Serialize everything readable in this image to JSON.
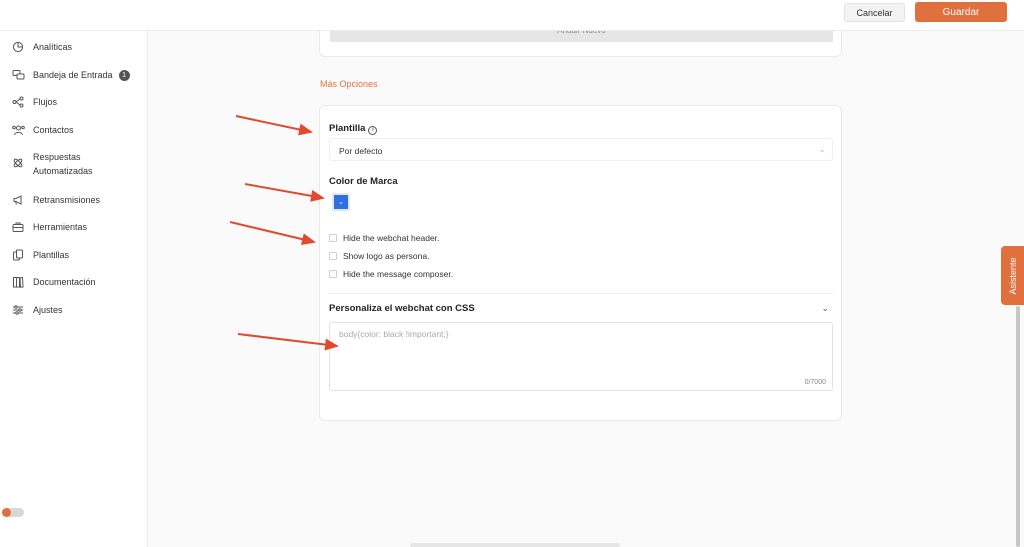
{
  "header": {
    "cancel_label": "Cancelar",
    "save_label": "Guardar"
  },
  "sidebar": {
    "items": [
      {
        "label": "Analíticas",
        "icon": "pie-chart-icon"
      },
      {
        "label": "Bandeja de Entrada",
        "icon": "chat-bubbles-icon",
        "badge": "1"
      },
      {
        "label": "Flujos",
        "icon": "flow-icon"
      },
      {
        "label": "Contactos",
        "icon": "contacts-icon"
      },
      {
        "label_line1": "Respuestas",
        "label_line2": "Automatizadas",
        "icon": "atom-icon"
      },
      {
        "label": "Retransmisiones",
        "icon": "megaphone-icon"
      },
      {
        "label": "Herramientas",
        "icon": "toolbox-icon"
      },
      {
        "label": "Plantillas",
        "icon": "templates-icon"
      },
      {
        "label": "Documentación",
        "icon": "books-icon"
      },
      {
        "label": "Ajustes",
        "icon": "sliders-icon"
      }
    ]
  },
  "top_card": {
    "add_button_label": "Añadir Nuevo"
  },
  "more_options": {
    "title": "Más Opciones",
    "template_label": "Plantilla",
    "template_value": "Por defecto",
    "brand_color_label": "Color de Marca",
    "brand_color": "#2f6fe0",
    "checkboxes": [
      {
        "label": "Hide the webchat header.",
        "checked": false
      },
      {
        "label": "Show logo as persona.",
        "checked": false
      },
      {
        "label": "Hide the message composer.",
        "checked": false
      }
    ],
    "css_section_title": "Personaliza el webchat con CSS",
    "css_placeholder": "body{color: black !important;}",
    "css_counter": "0/7000"
  },
  "assistant_tab": {
    "label": "Asistente"
  },
  "colors": {
    "accent": "#e0703e",
    "arrow": "#e04a2f"
  }
}
